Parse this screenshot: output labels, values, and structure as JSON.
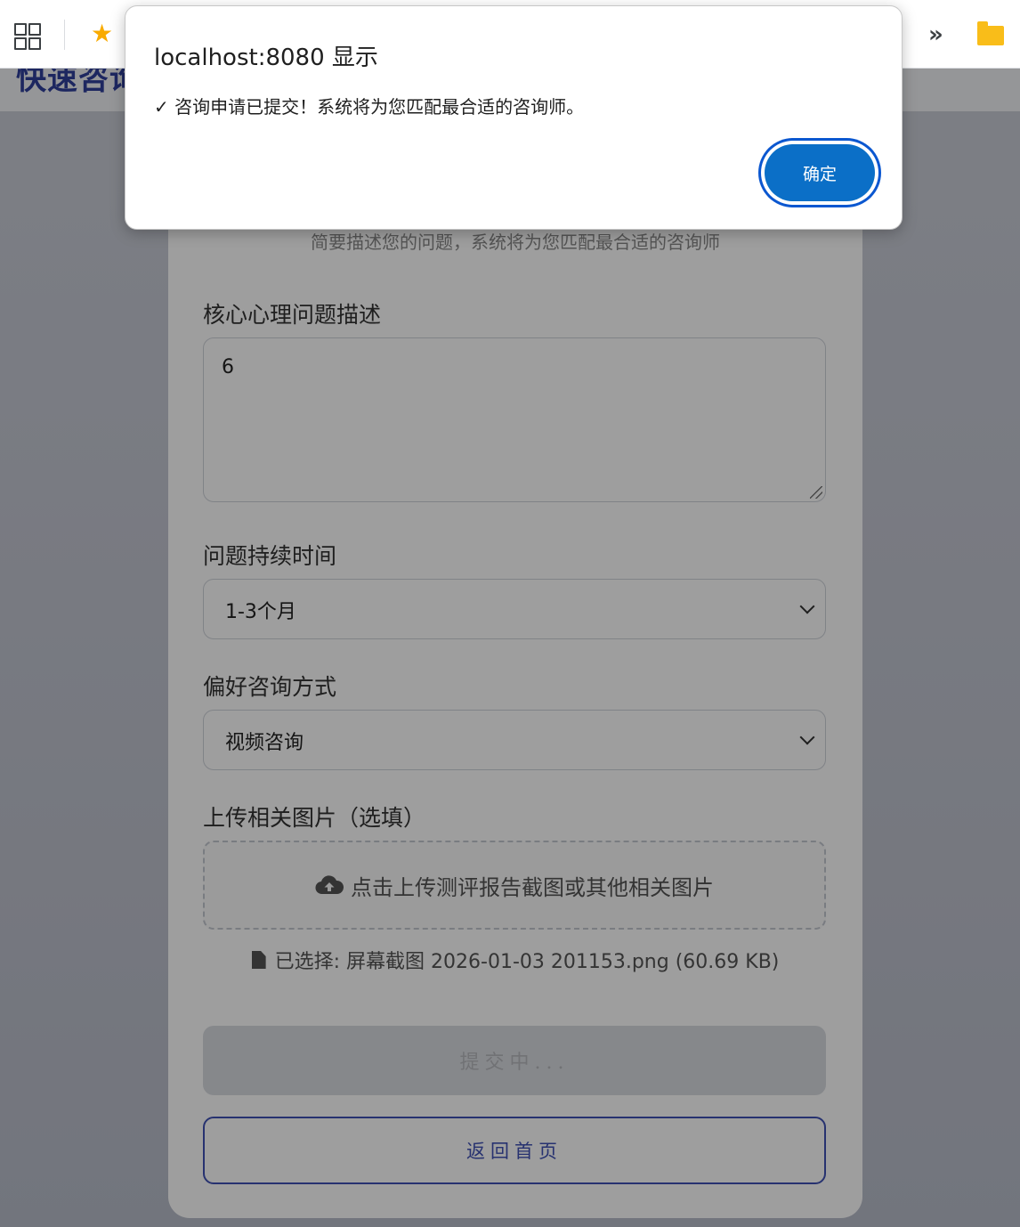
{
  "page": {
    "header_title": "快速咨询",
    "subtitle": "简要描述您的问题，系统将为您匹配最合适的咨询师"
  },
  "form": {
    "problem_label": "核心心理问题描述",
    "problem_value": "6",
    "duration_label": "问题持续时间",
    "duration_value": "1-3个月",
    "method_label": "偏好咨询方式",
    "method_value": "视频咨询",
    "upload_label": "上传相关图片（选填）",
    "upload_hint": "点击上传测评报告截图或其他相关图片",
    "selected_file": "已选择: 屏幕截图 2026-01-03 201153.png (60.69 KB)",
    "submit_label": "提交中...",
    "back_label": "返回首页"
  },
  "dialog": {
    "title": "localhost:8080 显示",
    "message": "✓ 咨询申请已提交！系统将为您匹配最合适的咨询师。",
    "ok_label": "确定"
  },
  "colors": {
    "accent": "#3f51b5",
    "dialog_button": "#0b6fc7",
    "star": "#f9ab00",
    "folder": "#f9bd19"
  }
}
